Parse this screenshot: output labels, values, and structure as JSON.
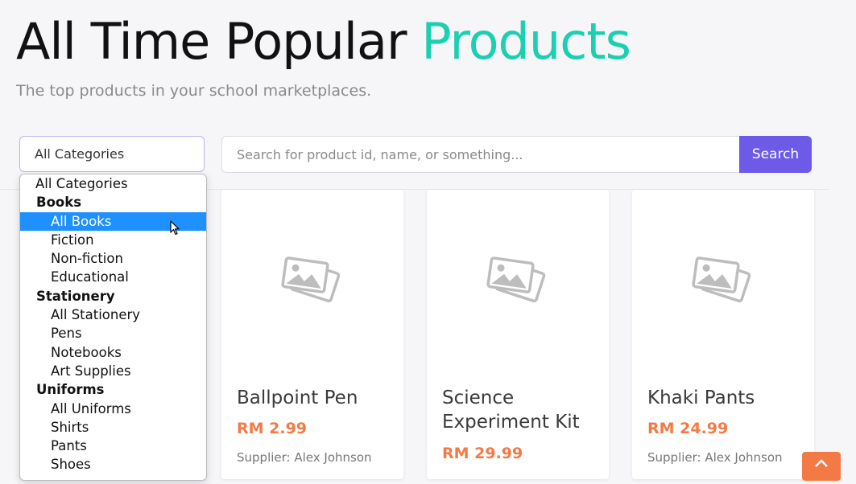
{
  "header": {
    "title_main": "All Time Popular",
    "title_accent": "Products",
    "subtitle": "The top products in your school marketplaces."
  },
  "filter": {
    "selected": "All Categories",
    "options": [
      {
        "kind": "option",
        "label": "All Categories"
      },
      {
        "kind": "group",
        "label": "Books"
      },
      {
        "kind": "sub",
        "label": "All Books",
        "highlighted": true
      },
      {
        "kind": "sub",
        "label": "Fiction"
      },
      {
        "kind": "sub",
        "label": "Non-fiction"
      },
      {
        "kind": "sub",
        "label": "Educational"
      },
      {
        "kind": "group",
        "label": "Stationery"
      },
      {
        "kind": "sub",
        "label": "All Stationery"
      },
      {
        "kind": "sub",
        "label": "Pens"
      },
      {
        "kind": "sub",
        "label": "Notebooks"
      },
      {
        "kind": "sub",
        "label": "Art Supplies"
      },
      {
        "kind": "group",
        "label": "Uniforms"
      },
      {
        "kind": "sub",
        "label": "All Uniforms"
      },
      {
        "kind": "sub",
        "label": "Shirts"
      },
      {
        "kind": "sub",
        "label": "Pants"
      },
      {
        "kind": "sub",
        "label": "Shoes"
      }
    ]
  },
  "search": {
    "placeholder": "Search for product id, name, or something...",
    "button_label": "Search"
  },
  "products": [
    {
      "name": "Ballpoint Pen",
      "price": "RM 2.99",
      "supplier": "Supplier: Alex Johnson"
    },
    {
      "name": "Science Experiment Kit",
      "price": "RM 29.99",
      "supplier": ""
    },
    {
      "name": "Khaki Pants",
      "price": "RM 24.99",
      "supplier": "Supplier: Alex Johnson"
    }
  ],
  "colors": {
    "accent": "#1ccfb0",
    "primary_button": "#6d5be8",
    "price": "#f47a45",
    "dropdown_highlight": "#1e90ff"
  },
  "icons": {
    "card_image": "image-placeholder-icon",
    "cursor": "mouse-pointer-icon",
    "scroll_top": "chevron-up-icon"
  }
}
